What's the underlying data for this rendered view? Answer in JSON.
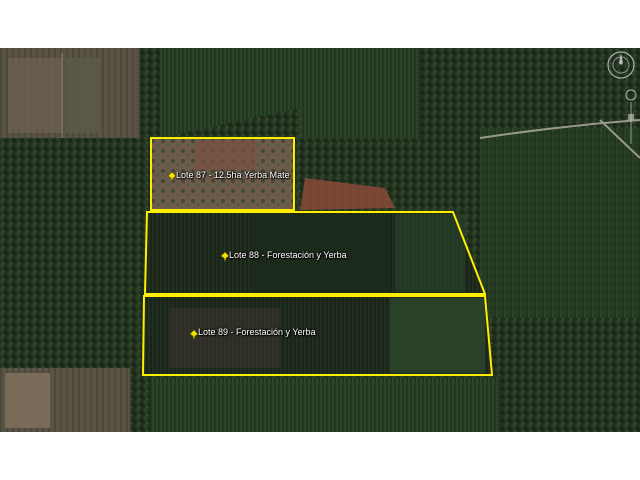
{
  "map": {
    "view": "satellite",
    "boundary_color": "#ffee00",
    "pin_color": "#f5e600",
    "lots": [
      {
        "id": "lote-87",
        "label": "Lote 87 - 12.5ha Yerba Mate"
      },
      {
        "id": "lote-88",
        "label": "Lote 88 - Forestación y Yerba"
      },
      {
        "id": "lote-89",
        "label": "Lote 89 - Forestación y Yerba"
      }
    ],
    "controls": {
      "compass_icon": "compass-icon",
      "navigation_icon": "navigation-control-icon"
    }
  }
}
